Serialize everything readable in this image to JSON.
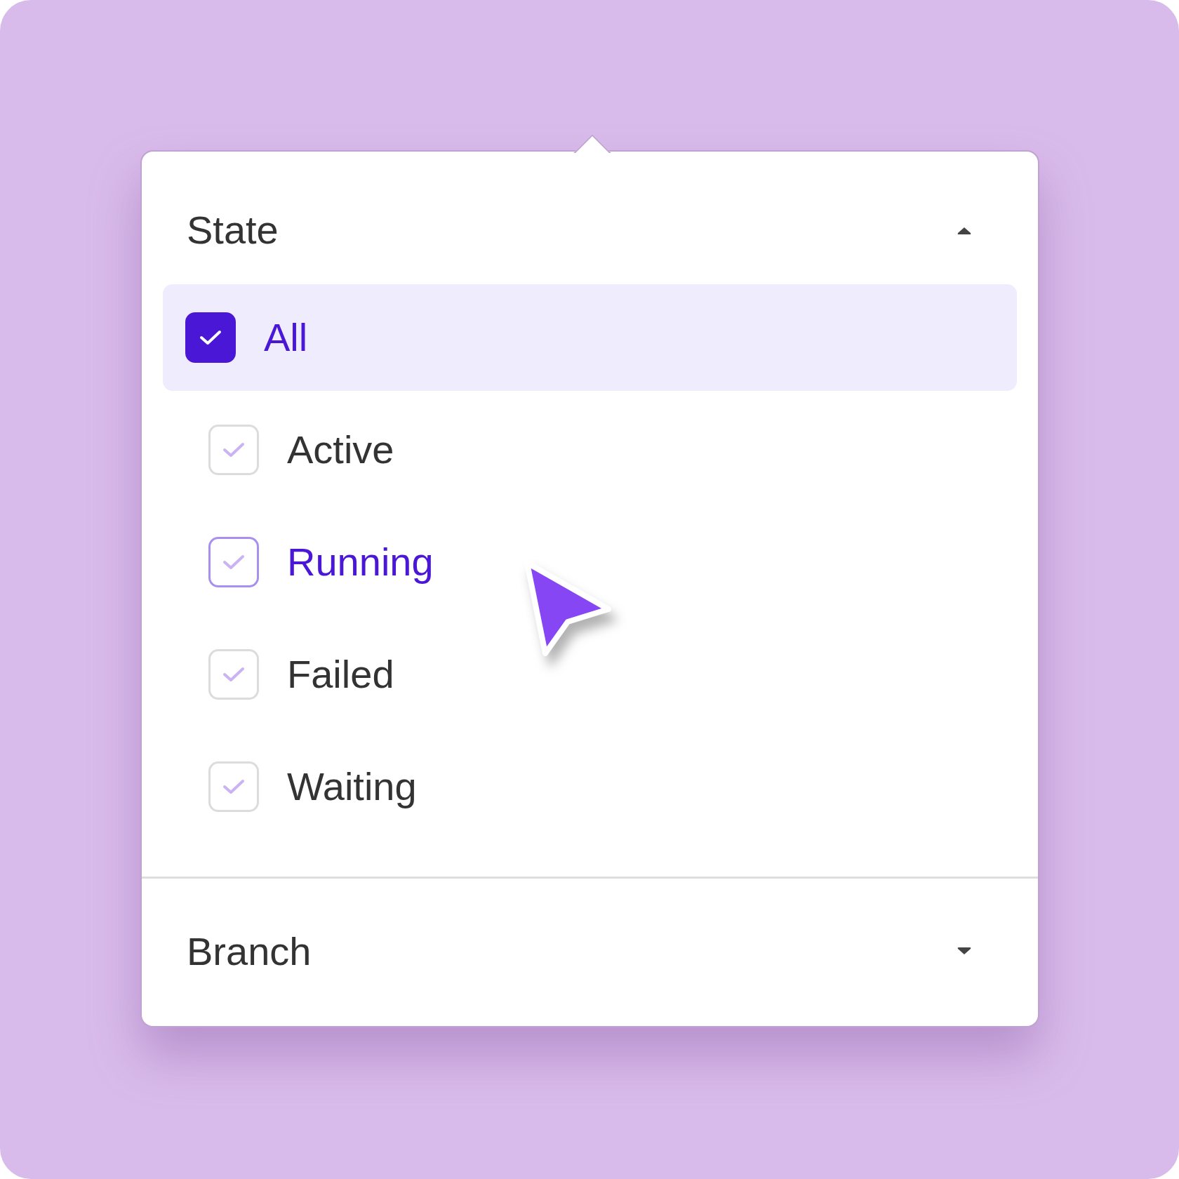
{
  "sections": [
    {
      "title": "State",
      "expanded": true,
      "options": [
        {
          "label": "All",
          "checked": true,
          "selected": true,
          "hovered": false,
          "indented": false
        },
        {
          "label": "Active",
          "checked": false,
          "selected": false,
          "hovered": false,
          "indented": true
        },
        {
          "label": "Running",
          "checked": false,
          "selected": false,
          "hovered": true,
          "indented": true
        },
        {
          "label": "Failed",
          "checked": false,
          "selected": false,
          "hovered": false,
          "indented": true
        },
        {
          "label": "Waiting",
          "checked": false,
          "selected": false,
          "hovered": false,
          "indented": true
        }
      ]
    },
    {
      "title": "Branch",
      "expanded": false
    }
  ]
}
